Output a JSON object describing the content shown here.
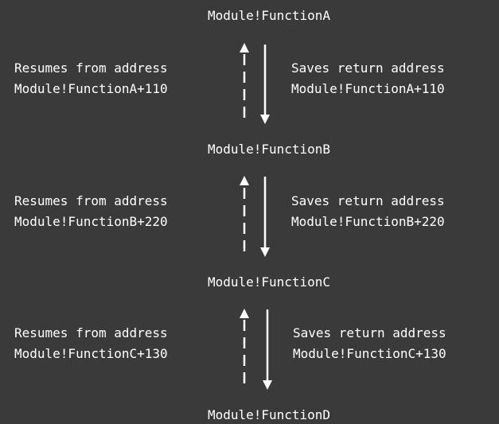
{
  "colors": {
    "background": "#3a3a3a",
    "foreground": "#ffffff"
  },
  "functions": [
    "Module!FunctionA",
    "Module!FunctionB",
    "Module!FunctionC",
    "Module!FunctionD"
  ],
  "transitions": [
    {
      "resume_label": "Resumes from address",
      "resume_address": "Module!FunctionA+110",
      "save_label": "Saves return address",
      "save_address": "Module!FunctionA+110"
    },
    {
      "resume_label": "Resumes from address",
      "resume_address": "Module!FunctionB+220",
      "save_label": "Saves return address",
      "save_address": "Module!FunctionB+220"
    },
    {
      "resume_label": "Resumes from address",
      "resume_address": "Module!FunctionC+130",
      "save_label": "Saves return address",
      "save_address": "Module!FunctionC+130"
    }
  ]
}
